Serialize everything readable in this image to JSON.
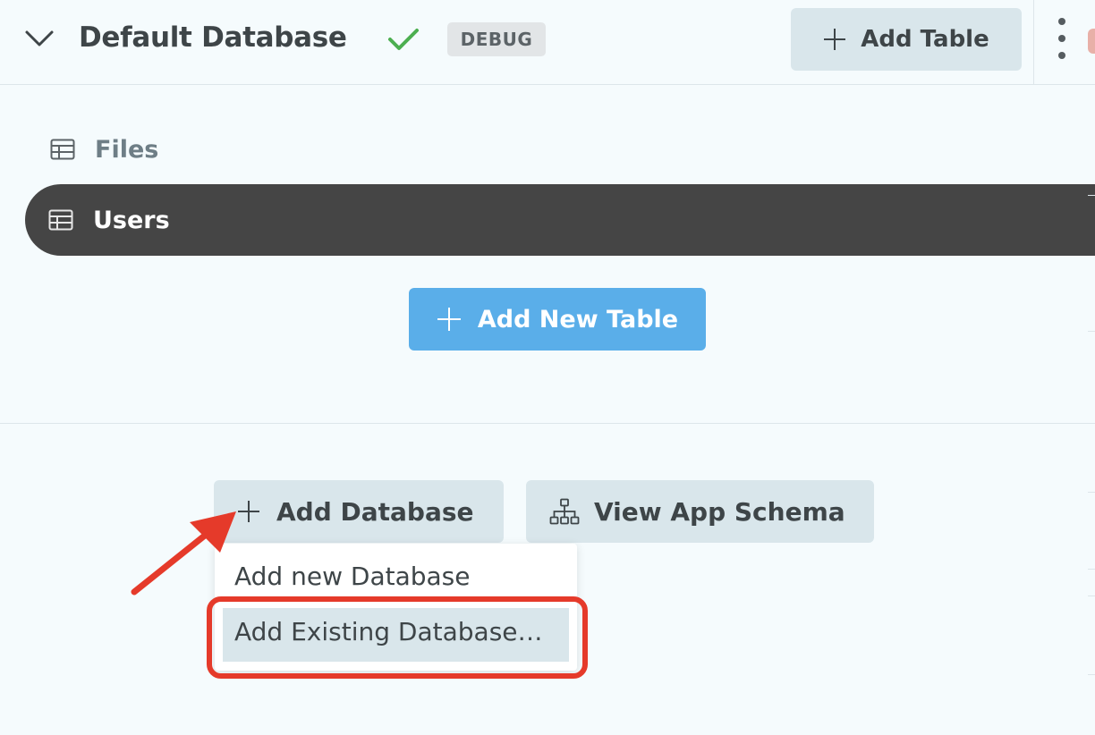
{
  "header": {
    "database_title": "Default Database",
    "debug_badge": "DEBUG",
    "add_table_label": "Add Table"
  },
  "tables": [
    {
      "label": "Files",
      "selected": false
    },
    {
      "label": "Users",
      "selected": true
    }
  ],
  "add_new_table_label": "Add New Table",
  "bottom": {
    "add_database_label": "Add Database",
    "view_schema_label": "View App Schema"
  },
  "dropdown": {
    "items": [
      {
        "label": "Add new Database"
      },
      {
        "label": "Add Existing Database…",
        "highlighted": true
      }
    ]
  },
  "colors": {
    "accent_blue": "#5aaee9",
    "success_green": "#4caf50",
    "annotation_red": "#e53a2a",
    "selected_row": "#454545"
  }
}
